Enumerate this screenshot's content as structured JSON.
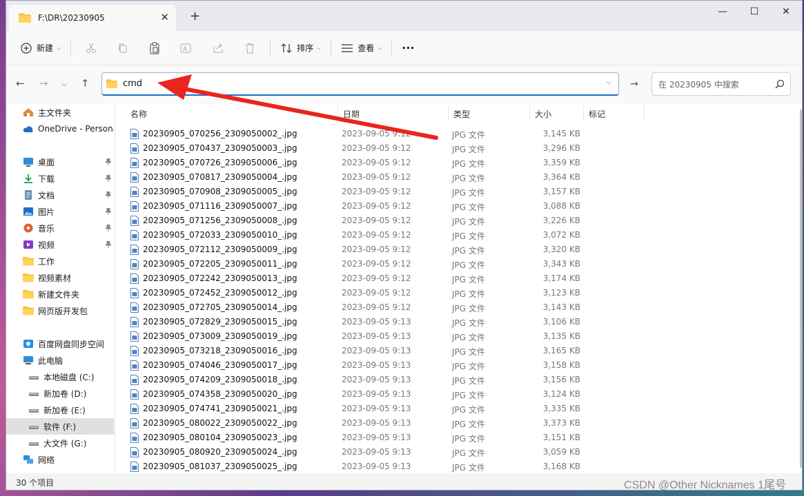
{
  "window": {
    "tab_title": "F:\\DR\\20230905"
  },
  "toolbar": {
    "new_label": "新建",
    "sort_label": "排序",
    "view_label": "查看",
    "more_label": "···"
  },
  "address": {
    "value": "cmd"
  },
  "search": {
    "placeholder": "在 20230905 中搜索"
  },
  "sidebar": {
    "items": [
      {
        "label": "主文件夹",
        "icon": "home-icon"
      },
      {
        "label": "OneDrive - Persona",
        "icon": "cloud-icon"
      },
      {
        "label": "桌面",
        "icon": "desktop-icon",
        "pinned": true
      },
      {
        "label": "下载",
        "icon": "download-icon",
        "pinned": true
      },
      {
        "label": "文档",
        "icon": "document-icon",
        "pinned": true
      },
      {
        "label": "图片",
        "icon": "picture-icon",
        "pinned": true
      },
      {
        "label": "音乐",
        "icon": "music-icon",
        "pinned": true
      },
      {
        "label": "视频",
        "icon": "video-icon",
        "pinned": true
      },
      {
        "label": "工作",
        "icon": "folder-icon"
      },
      {
        "label": "视频素材",
        "icon": "folder-icon"
      },
      {
        "label": "新建文件夹",
        "icon": "folder-icon"
      },
      {
        "label": "网页版开发包",
        "icon": "folder-icon"
      },
      {
        "label": "百度网盘同步空间",
        "icon": "baidu-netdisk-icon"
      },
      {
        "label": "此电脑",
        "icon": "computer-icon"
      },
      {
        "label": "本地磁盘 (C:)",
        "icon": "drive-icon"
      },
      {
        "label": "新加卷 (D:)",
        "icon": "drive-icon"
      },
      {
        "label": "新加卷 (E:)",
        "icon": "drive-icon"
      },
      {
        "label": "软件 (F:)",
        "icon": "drive-icon",
        "selected": true
      },
      {
        "label": "大文件 (G:)",
        "icon": "drive-icon"
      },
      {
        "label": "网络",
        "icon": "network-icon"
      }
    ]
  },
  "columns": {
    "name": "名称",
    "date": "日期",
    "type": "类型",
    "size": "大小",
    "tags": "标记"
  },
  "files": [
    {
      "name": "20230905_070256_2309050002_.jpg",
      "date": "2023-09-05 9:12",
      "type": "JPG 文件",
      "size": "3,145 KB"
    },
    {
      "name": "20230905_070437_2309050003_.jpg",
      "date": "2023-09-05 9:12",
      "type": "JPG 文件",
      "size": "3,296 KB"
    },
    {
      "name": "20230905_070726_2309050006_.jpg",
      "date": "2023-09-05 9:12",
      "type": "JPG 文件",
      "size": "3,359 KB"
    },
    {
      "name": "20230905_070817_2309050004_.jpg",
      "date": "2023-09-05 9:12",
      "type": "JPG 文件",
      "size": "3,364 KB"
    },
    {
      "name": "20230905_070908_2309050005_.jpg",
      "date": "2023-09-05 9:12",
      "type": "JPG 文件",
      "size": "3,157 KB"
    },
    {
      "name": "20230905_071116_2309050007_.jpg",
      "date": "2023-09-05 9:12",
      "type": "JPG 文件",
      "size": "3,088 KB"
    },
    {
      "name": "20230905_071256_2309050008_.jpg",
      "date": "2023-09-05 9:12",
      "type": "JPG 文件",
      "size": "3,226 KB"
    },
    {
      "name": "20230905_072033_2309050010_.jpg",
      "date": "2023-09-05 9:12",
      "type": "JPG 文件",
      "size": "3,072 KB"
    },
    {
      "name": "20230905_072112_2309050009_.jpg",
      "date": "2023-09-05 9:12",
      "type": "JPG 文件",
      "size": "3,320 KB"
    },
    {
      "name": "20230905_072205_2309050011_.jpg",
      "date": "2023-09-05 9:12",
      "type": "JPG 文件",
      "size": "3,343 KB"
    },
    {
      "name": "20230905_072242_2309050013_.jpg",
      "date": "2023-09-05 9:12",
      "type": "JPG 文件",
      "size": "3,174 KB"
    },
    {
      "name": "20230905_072452_2309050012_.jpg",
      "date": "2023-09-05 9:12",
      "type": "JPG 文件",
      "size": "3,123 KB"
    },
    {
      "name": "20230905_072705_2309050014_.jpg",
      "date": "2023-09-05 9:12",
      "type": "JPG 文件",
      "size": "3,143 KB"
    },
    {
      "name": "20230905_072829_2309050015_.jpg",
      "date": "2023-09-05 9:13",
      "type": "JPG 文件",
      "size": "3,106 KB"
    },
    {
      "name": "20230905_073009_2309050019_.jpg",
      "date": "2023-09-05 9:13",
      "type": "JPG 文件",
      "size": "3,135 KB"
    },
    {
      "name": "20230905_073218_2309050016_.jpg",
      "date": "2023-09-05 9:13",
      "type": "JPG 文件",
      "size": "3,165 KB"
    },
    {
      "name": "20230905_074046_2309050017_.jpg",
      "date": "2023-09-05 9:13",
      "type": "JPG 文件",
      "size": "3,158 KB"
    },
    {
      "name": "20230905_074209_2309050018_.jpg",
      "date": "2023-09-05 9:13",
      "type": "JPG 文件",
      "size": "3,156 KB"
    },
    {
      "name": "20230905_074358_2309050020_.jpg",
      "date": "2023-09-05 9:13",
      "type": "JPG 文件",
      "size": "3,124 KB"
    },
    {
      "name": "20230905_074741_2309050021_.jpg",
      "date": "2023-09-05 9:13",
      "type": "JPG 文件",
      "size": "3,335 KB"
    },
    {
      "name": "20230905_080022_2309050022_.jpg",
      "date": "2023-09-05 9:13",
      "type": "JPG 文件",
      "size": "3,373 KB"
    },
    {
      "name": "20230905_080104_2309050023_.jpg",
      "date": "2023-09-05 9:13",
      "type": "JPG 文件",
      "size": "3,151 KB"
    },
    {
      "name": "20230905_080920_2309050024_.jpg",
      "date": "2023-09-05 9:13",
      "type": "JPG 文件",
      "size": "3,059 KB"
    },
    {
      "name": "20230905_081037_2309050025_.jpg",
      "date": "2023-09-05 9:13",
      "type": "JPG 文件",
      "size": "3,168 KB"
    }
  ],
  "status": {
    "count": "30 个项目"
  },
  "watermark": "CSDN @Other Nicknames 1尾号",
  "colors": {
    "accent": "#1f6fc5",
    "arrow": "#e8251e",
    "folder": "#f5c542"
  }
}
